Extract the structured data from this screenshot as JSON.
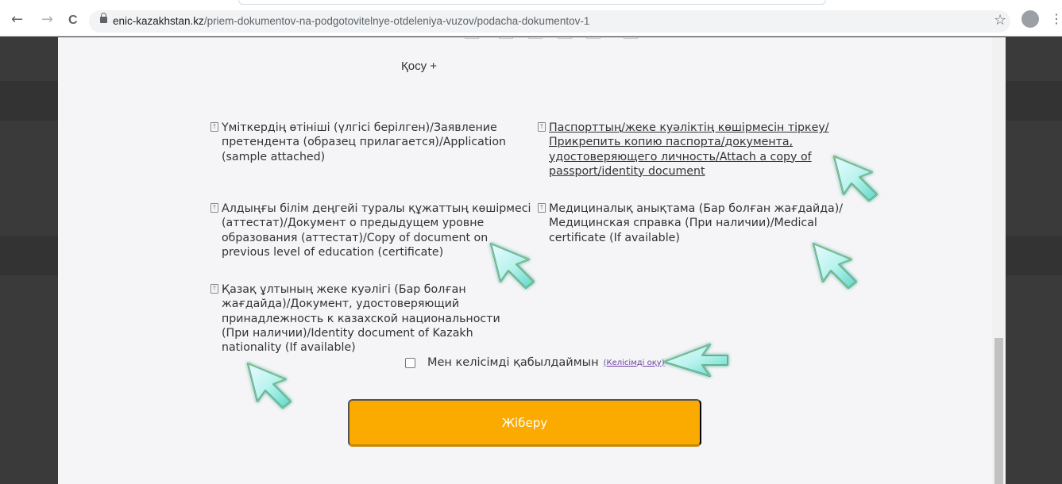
{
  "browser": {
    "url_domain": "enic-kazakhstan.kz",
    "url_path": "/priem-dokumentov-na-podgotovitelnye-otdeleniya-vuzov/podacha-dokumentov-1",
    "back_icon": "←",
    "forward_icon": "→",
    "reload_icon": "C",
    "bookmark_icon": "☆",
    "menu_icon": "⋮"
  },
  "form": {
    "add_label": "Қосу +",
    "documents": [
      {
        "lines": [
          "Үміткердің өтініші (үлгісі берілген)/Заявление",
          "претендента (образец прилагается)/Application",
          "(sample attached)"
        ]
      },
      {
        "lines": [
          "Паспорттың/жеке куәліктің көшірмесін тіркеу/",
          "Прикрепить копию паспорта/документа,",
          "удостоверяющего личность/Attach a copy of",
          "passport/identity document"
        ]
      },
      {
        "lines": [
          "Алдыңғы білім деңгейі туралы құжаттың көшірмесі",
          "(аттестат)/Документ о предыдущем уровне",
          "образования (аттестат)/Copy of document on",
          "previous level of education (certificate)"
        ]
      },
      {
        "lines": [
          "Медициналық анықтама (Бар болған жағдайда)/",
          "Медицинская справка (При наличии)/Medical",
          "certificate (If available)"
        ]
      },
      {
        "lines": [
          "Қазақ ұлтының жеке куәлігі (Бар болған",
          "жағдайда)/Документ, удостоверяющий",
          "принадлежность к казахской национальности",
          "(При наличии)/Identity document of Kazakh",
          "nationality (If available)"
        ]
      }
    ],
    "agreement_label": "Мен келісімді қабылдаймын",
    "agreement_link": "(Келісімді оқу)",
    "submit_label": "Жіберу"
  },
  "colors": {
    "submit": "#fbab00",
    "page": "#f5f5f7",
    "backdrop": "#3a3a3a"
  }
}
